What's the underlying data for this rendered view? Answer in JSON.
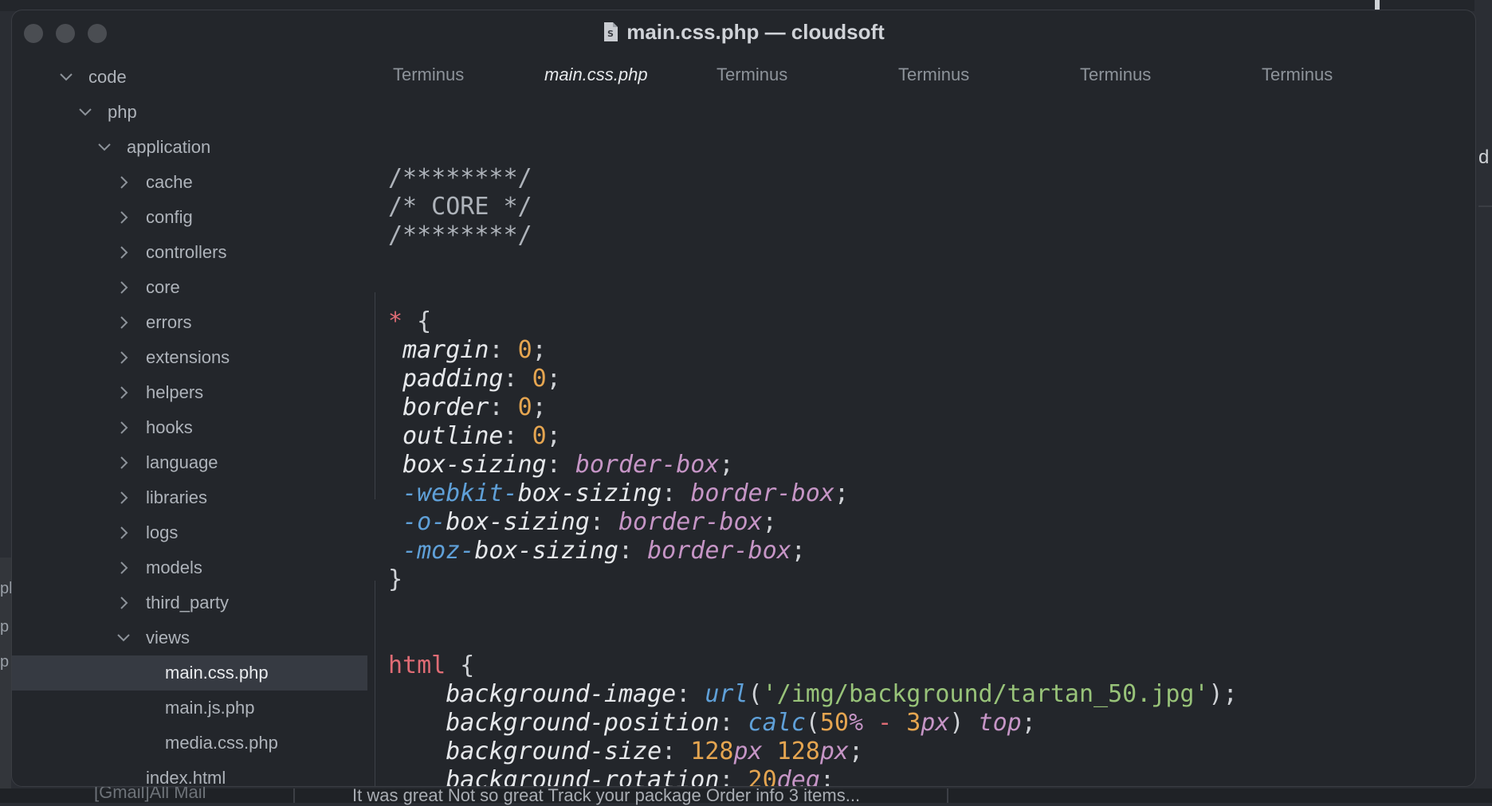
{
  "background": {
    "right_fragment_letter": "d",
    "left_fragments": [
      "ph",
      "p",
      "p"
    ],
    "bottom_preview_text": "It was great Not so great Track your package Order info 3 items...",
    "bottom_mail_text": "[Gmail]All Mail"
  },
  "window": {
    "title": "main.css.php — cloudsoft",
    "file_icon": "file-icon"
  },
  "sidebar": {
    "items": [
      {
        "label": "code",
        "icon": "chevron-down"
      },
      {
        "label": "php",
        "icon": "chevron-down"
      },
      {
        "label": "application",
        "icon": "chevron-down"
      },
      {
        "label": "cache",
        "icon": "chevron-right"
      },
      {
        "label": "config",
        "icon": "chevron-right"
      },
      {
        "label": "controllers",
        "icon": "chevron-right"
      },
      {
        "label": "core",
        "icon": "chevron-right"
      },
      {
        "label": "errors",
        "icon": "chevron-right"
      },
      {
        "label": "extensions",
        "icon": "chevron-right"
      },
      {
        "label": "helpers",
        "icon": "chevron-right"
      },
      {
        "label": "hooks",
        "icon": "chevron-right"
      },
      {
        "label": "language",
        "icon": "chevron-right"
      },
      {
        "label": "libraries",
        "icon": "chevron-right"
      },
      {
        "label": "logs",
        "icon": "chevron-right"
      },
      {
        "label": "models",
        "icon": "chevron-right"
      },
      {
        "label": "third_party",
        "icon": "chevron-right"
      },
      {
        "label": "views",
        "icon": "chevron-down"
      },
      {
        "label": "main.css.php",
        "icon": "",
        "selected": true
      },
      {
        "label": "main.js.php",
        "icon": ""
      },
      {
        "label": "media.css.php",
        "icon": ""
      },
      {
        "label": "index.html",
        "icon": ""
      }
    ]
  },
  "tabs": [
    {
      "label": "Terminus",
      "active": false
    },
    {
      "label": "main.css.php",
      "active": true
    },
    {
      "label": "Terminus",
      "active": false
    },
    {
      "label": "Terminus",
      "active": false
    },
    {
      "label": "Terminus",
      "active": false
    },
    {
      "label": "Terminus",
      "active": false
    }
  ],
  "code": {
    "lines": [
      [
        {
          "t": "/********/",
          "c": "comment"
        }
      ],
      [
        {
          "t": "/* CORE */",
          "c": "comment"
        }
      ],
      [
        {
          "t": "/********/",
          "c": "comment"
        }
      ],
      [],
      [],
      [
        {
          "t": "*",
          "c": "sel"
        },
        {
          "t": " {",
          "c": "punc"
        }
      ],
      [
        {
          "t": " margin",
          "c": "prop"
        },
        {
          "t": ": ",
          "c": "punc"
        },
        {
          "t": "0",
          "c": "num"
        },
        {
          "t": ";",
          "c": "punc"
        }
      ],
      [
        {
          "t": " padding",
          "c": "prop"
        },
        {
          "t": ": ",
          "c": "punc"
        },
        {
          "t": "0",
          "c": "num"
        },
        {
          "t": ";",
          "c": "punc"
        }
      ],
      [
        {
          "t": " border",
          "c": "prop"
        },
        {
          "t": ": ",
          "c": "punc"
        },
        {
          "t": "0",
          "c": "num"
        },
        {
          "t": ";",
          "c": "punc"
        }
      ],
      [
        {
          "t": " outline",
          "c": "prop"
        },
        {
          "t": ": ",
          "c": "punc"
        },
        {
          "t": "0",
          "c": "num"
        },
        {
          "t": ";",
          "c": "punc"
        }
      ],
      [
        {
          "t": " box-sizing",
          "c": "prop"
        },
        {
          "t": ": ",
          "c": "punc"
        },
        {
          "t": "border-box",
          "c": "kw"
        },
        {
          "t": ";",
          "c": "punc"
        }
      ],
      [
        {
          "t": " -webkit-",
          "c": "vendor"
        },
        {
          "t": "box-sizing",
          "c": "prop"
        },
        {
          "t": ": ",
          "c": "punc"
        },
        {
          "t": "border-box",
          "c": "kw"
        },
        {
          "t": ";",
          "c": "punc"
        }
      ],
      [
        {
          "t": " -o-",
          "c": "vendor"
        },
        {
          "t": "box-sizing",
          "c": "prop"
        },
        {
          "t": ": ",
          "c": "punc"
        },
        {
          "t": "border-box",
          "c": "kw"
        },
        {
          "t": ";",
          "c": "punc"
        }
      ],
      [
        {
          "t": " -moz-",
          "c": "vendor"
        },
        {
          "t": "box-sizing",
          "c": "prop"
        },
        {
          "t": ": ",
          "c": "punc"
        },
        {
          "t": "border-box",
          "c": "kw"
        },
        {
          "t": ";",
          "c": "punc"
        }
      ],
      [
        {
          "t": "}",
          "c": "punc"
        }
      ],
      [],
      [],
      [
        {
          "t": "html",
          "c": "sel"
        },
        {
          "t": " {",
          "c": "punc"
        }
      ],
      [
        {
          "t": "    background-image",
          "c": "prop"
        },
        {
          "t": ": ",
          "c": "punc"
        },
        {
          "t": "url",
          "c": "fn"
        },
        {
          "t": "(",
          "c": "punc"
        },
        {
          "t": "'/img/background/tartan_50.jpg'",
          "c": "str"
        },
        {
          "t": ");",
          "c": "punc"
        }
      ],
      [
        {
          "t": "    background-position",
          "c": "prop"
        },
        {
          "t": ": ",
          "c": "punc"
        },
        {
          "t": "calc",
          "c": "fn"
        },
        {
          "t": "(",
          "c": "punc"
        },
        {
          "t": "50",
          "c": "num"
        },
        {
          "t": "%",
          "c": "kw"
        },
        {
          "t": " - ",
          "c": "sel"
        },
        {
          "t": "3",
          "c": "num"
        },
        {
          "t": "px",
          "c": "kw"
        },
        {
          "t": ") ",
          "c": "punc"
        },
        {
          "t": "top",
          "c": "kw"
        },
        {
          "t": ";",
          "c": "punc"
        }
      ],
      [
        {
          "t": "    background-size",
          "c": "prop"
        },
        {
          "t": ": ",
          "c": "punc"
        },
        {
          "t": "128",
          "c": "num"
        },
        {
          "t": "px",
          "c": "kw"
        },
        {
          "t": " ",
          "c": "punc"
        },
        {
          "t": "128",
          "c": "num"
        },
        {
          "t": "px",
          "c": "kw"
        },
        {
          "t": ";",
          "c": "punc"
        }
      ],
      [
        {
          "t": "    background-rotation",
          "c": "prop"
        },
        {
          "t": ": ",
          "c": "punc"
        },
        {
          "t": "20",
          "c": "num"
        },
        {
          "t": "deg",
          "c": "kw"
        },
        {
          "t": ";",
          "c": "punc"
        }
      ]
    ]
  }
}
